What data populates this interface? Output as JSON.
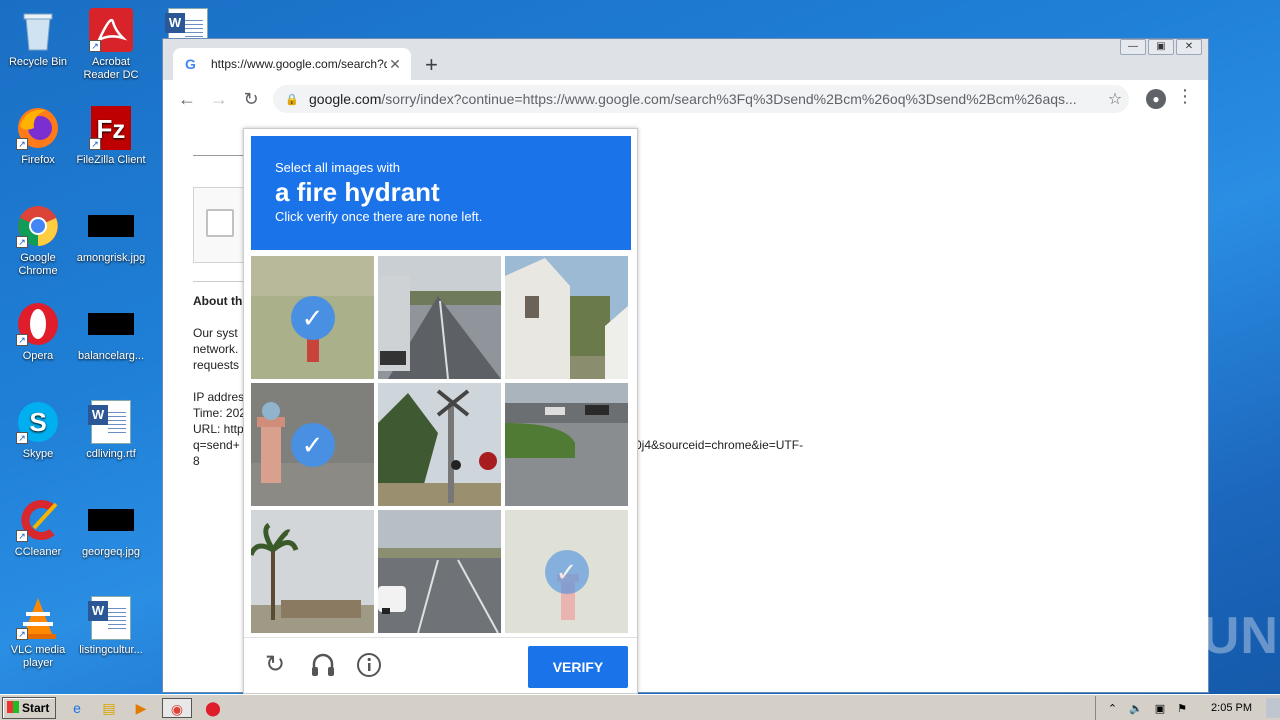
{
  "desktop": {
    "icons": [
      {
        "label": "Recycle Bin"
      },
      {
        "label": "Acrobat Reader DC"
      },
      {
        "label": "Firefox"
      },
      {
        "label": "FileZilla Client"
      },
      {
        "label": "Google Chrome"
      },
      {
        "label": "amongrisk.jpg"
      },
      {
        "label": "Opera"
      },
      {
        "label": "balancelarg..."
      },
      {
        "label": "Skype"
      },
      {
        "label": "cdliving.rtf"
      },
      {
        "label": "CCleaner"
      },
      {
        "label": "georgeq.jpg"
      },
      {
        "label": "VLC media player"
      },
      {
        "label": "listingcultur..."
      }
    ]
  },
  "browser": {
    "tab_title": "https://www.google.com/search?q=",
    "address_domain": "google.com",
    "address_path": "/sorry/index?continue=https://www.google.com/search%3Fq%3Dsend%2Bcm%26oq%3Dsend%2Bcm%26aqs..."
  },
  "page": {
    "about_heading": "About th",
    "para_lines": [
      "Our syst",
      "network.",
      "requests"
    ],
    "ip_lines": [
      "IP addres",
      "Time: 202",
      "URL: http",
      "q=send+",
      "8"
    ],
    "url_tail": "0j4&sourceid=chrome&ie=UTF-"
  },
  "captcha": {
    "instruction_line1": "Select all images with",
    "target": "a fire hydrant",
    "instruction_line3": "Click verify once there are none left.",
    "verify_label": "VERIFY",
    "tiles_selected": [
      true,
      false,
      false,
      true,
      false,
      false,
      false,
      false,
      false
    ],
    "tiles_fading": [
      false,
      false,
      false,
      false,
      false,
      false,
      false,
      false,
      true
    ]
  },
  "taskbar": {
    "start_label": "Start",
    "clock": "2:05 PM"
  },
  "watermark": "ANY RUN"
}
